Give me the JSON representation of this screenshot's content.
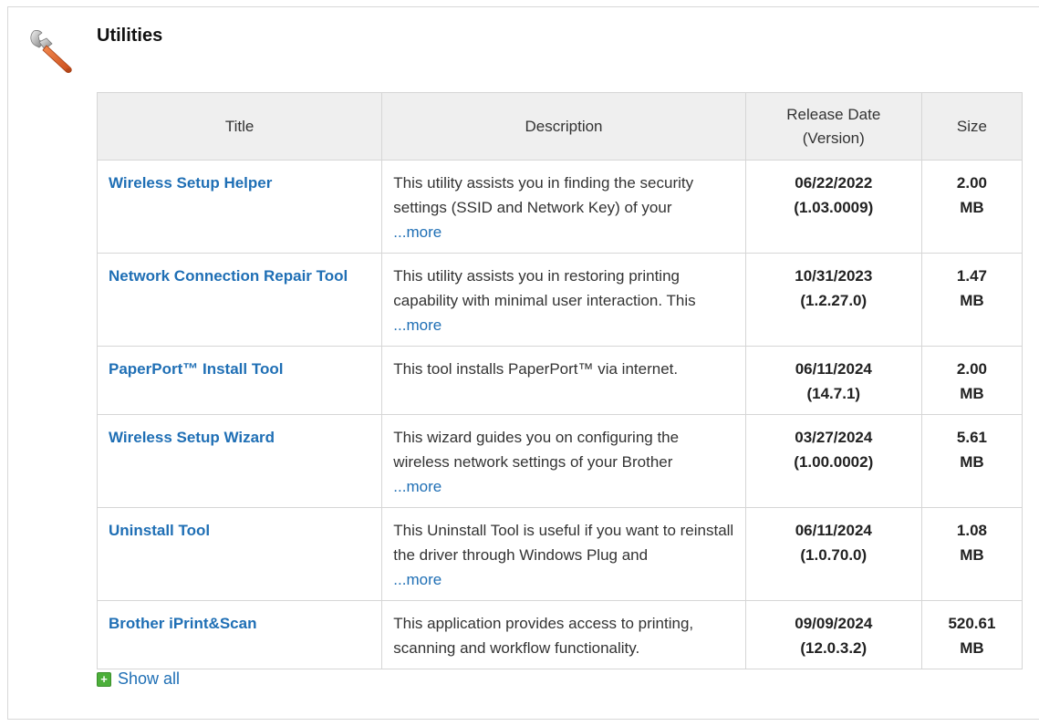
{
  "section": {
    "title": "Utilities",
    "icon": "wrench-icon"
  },
  "table": {
    "headers": {
      "title": "Title",
      "description": "Description",
      "release_date_line1": "Release Date",
      "release_date_line2": "(Version)",
      "size": "Size"
    },
    "rows": [
      {
        "title": "Wireless Setup Helper",
        "description": "This utility assists you in finding the security settings (SSID and Network Key) of your",
        "more": "...more",
        "date": "06/22/2022",
        "version": "(1.03.0009)",
        "size_value": "2.00",
        "size_unit": "MB"
      },
      {
        "title": "Network Connection Repair Tool",
        "description": "This utility assists you in restoring printing capability with minimal user interaction. This",
        "more": "...more",
        "date": "10/31/2023",
        "version": "(1.2.27.0)",
        "size_value": "1.47",
        "size_unit": "MB"
      },
      {
        "title": "PaperPort™ Install Tool",
        "description": "This tool installs PaperPort™ via internet.",
        "more": "",
        "date": "06/11/2024",
        "version": "(14.7.1)",
        "size_value": "2.00",
        "size_unit": "MB"
      },
      {
        "title": "Wireless Setup Wizard",
        "description": "This wizard guides you on configuring the wireless network settings of your Brother",
        "more": "...more",
        "date": "03/27/2024",
        "version": "(1.00.0002)",
        "size_value": "5.61",
        "size_unit": "MB"
      },
      {
        "title": "Uninstall Tool",
        "description": "This Uninstall Tool is useful if you want to reinstall the driver through Windows Plug and",
        "more": "...more",
        "date": "06/11/2024",
        "version": "(1.0.70.0)",
        "size_value": "1.08",
        "size_unit": "MB"
      },
      {
        "title": "Brother iPrint&Scan",
        "description": "This application provides access to printing, scanning and workflow functionality.",
        "more": "",
        "date": "09/09/2024",
        "version": "(12.0.3.2)",
        "size_value": "520.61",
        "size_unit": "MB"
      }
    ]
  },
  "show_all": {
    "icon": "plus-icon",
    "label": "Show all"
  },
  "colors": {
    "link": "#1f6fb5",
    "header_bg": "#efefef",
    "border": "#d6d6d6",
    "plus_green": "#4caf3a",
    "wrench_orange": "#e0602a"
  }
}
